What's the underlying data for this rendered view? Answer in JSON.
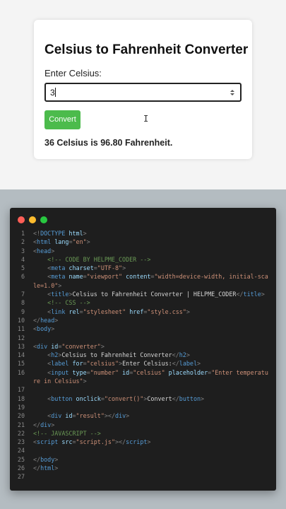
{
  "app": {
    "heading": "Celsius to Fahrenheit Converter",
    "input_label": "Enter Celsius:",
    "input_value": "3",
    "button_label": "Convert",
    "result": "36 Celsius is 96.80 Fahrenheit.",
    "colors": {
      "button": "#4cbb4c",
      "card": "#ffffff",
      "background": "#f4f4f4"
    }
  },
  "editor": {
    "window_buttons": [
      {
        "name": "close",
        "color": "#ff5f57"
      },
      {
        "name": "minimize",
        "color": "#febc2e"
      },
      {
        "name": "maximize",
        "color": "#28c840"
      }
    ],
    "lines": [
      {
        "n": "1",
        "code": [
          [
            "p",
            "<!"
          ],
          [
            "t",
            "DOCTYPE"
          ],
          [
            "w",
            " "
          ],
          [
            "a",
            "html"
          ],
          [
            "p",
            ">"
          ]
        ]
      },
      {
        "n": "2",
        "code": [
          [
            "p",
            "<"
          ],
          [
            "t",
            "html"
          ],
          [
            "w",
            " "
          ],
          [
            "a",
            "lang"
          ],
          [
            "p",
            "="
          ],
          [
            "s",
            "\"en\""
          ],
          [
            "p",
            ">"
          ]
        ]
      },
      {
        "n": "3",
        "code": [
          [
            "p",
            "<"
          ],
          [
            "t",
            "head"
          ],
          [
            "p",
            ">"
          ]
        ]
      },
      {
        "n": "4",
        "code": [
          [
            "w",
            "    "
          ],
          [
            "c",
            "<!-- CODE BY HELPME_CODER -->"
          ]
        ]
      },
      {
        "n": "5",
        "code": [
          [
            "w",
            "    "
          ],
          [
            "p",
            "<"
          ],
          [
            "t",
            "meta"
          ],
          [
            "w",
            " "
          ],
          [
            "a",
            "charset"
          ],
          [
            "p",
            "="
          ],
          [
            "s",
            "\"UTF-8\""
          ],
          [
            "p",
            ">"
          ]
        ]
      },
      {
        "n": "6",
        "code": [
          [
            "w",
            "    "
          ],
          [
            "p",
            "<"
          ],
          [
            "t",
            "meta"
          ],
          [
            "w",
            " "
          ],
          [
            "a",
            "name"
          ],
          [
            "p",
            "="
          ],
          [
            "s",
            "\"viewport\""
          ],
          [
            "w",
            " "
          ],
          [
            "a",
            "content"
          ],
          [
            "p",
            "="
          ],
          [
            "s",
            "\"width=device-width, initial-sca"
          ]
        ]
      },
      {
        "n": "",
        "code": [
          [
            "s",
            "le=1.0\""
          ],
          [
            "p",
            ">"
          ]
        ]
      },
      {
        "n": "7",
        "code": [
          [
            "w",
            "    "
          ],
          [
            "p",
            "<"
          ],
          [
            "t",
            "title"
          ],
          [
            "p",
            ">"
          ],
          [
            "w",
            "Celsius to Fahrenheit Converter | HELPME_CODER"
          ],
          [
            "p",
            "</"
          ],
          [
            "t",
            "title"
          ],
          [
            "p",
            ">"
          ]
        ]
      },
      {
        "n": "8",
        "code": [
          [
            "w",
            "    "
          ],
          [
            "c",
            "<!-- CSS -->"
          ]
        ]
      },
      {
        "n": "9",
        "code": [
          [
            "w",
            "    "
          ],
          [
            "p",
            "<"
          ],
          [
            "t",
            "link"
          ],
          [
            "w",
            " "
          ],
          [
            "a",
            "rel"
          ],
          [
            "p",
            "="
          ],
          [
            "s",
            "\"stylesheet\""
          ],
          [
            "w",
            " "
          ],
          [
            "a",
            "href"
          ],
          [
            "p",
            "="
          ],
          [
            "s",
            "\"style.css\""
          ],
          [
            "p",
            ">"
          ]
        ]
      },
      {
        "n": "10",
        "code": [
          [
            "p",
            "</"
          ],
          [
            "t",
            "head"
          ],
          [
            "p",
            ">"
          ]
        ]
      },
      {
        "n": "11",
        "code": [
          [
            "p",
            "<"
          ],
          [
            "t",
            "body"
          ],
          [
            "p",
            ">"
          ]
        ]
      },
      {
        "n": "12",
        "code": []
      },
      {
        "n": "13",
        "code": [
          [
            "p",
            "<"
          ],
          [
            "t",
            "div"
          ],
          [
            "w",
            " "
          ],
          [
            "a",
            "id"
          ],
          [
            "p",
            "="
          ],
          [
            "s",
            "\"converter\""
          ],
          [
            "p",
            ">"
          ]
        ]
      },
      {
        "n": "14",
        "code": [
          [
            "w",
            "    "
          ],
          [
            "p",
            "<"
          ],
          [
            "t",
            "h2"
          ],
          [
            "p",
            ">"
          ],
          [
            "w",
            "Celsius to Fahrenheit Converter"
          ],
          [
            "p",
            "</"
          ],
          [
            "t",
            "h2"
          ],
          [
            "p",
            ">"
          ]
        ]
      },
      {
        "n": "15",
        "code": [
          [
            "w",
            "    "
          ],
          [
            "p",
            "<"
          ],
          [
            "t",
            "label"
          ],
          [
            "w",
            " "
          ],
          [
            "a",
            "for"
          ],
          [
            "p",
            "="
          ],
          [
            "s",
            "\"celsius\""
          ],
          [
            "p",
            ">"
          ],
          [
            "w",
            "Enter Celsius:"
          ],
          [
            "p",
            "</"
          ],
          [
            "t",
            "label"
          ],
          [
            "p",
            ">"
          ]
        ]
      },
      {
        "n": "16",
        "code": [
          [
            "w",
            "    "
          ],
          [
            "p",
            "<"
          ],
          [
            "t",
            "input"
          ],
          [
            "w",
            " "
          ],
          [
            "a",
            "type"
          ],
          [
            "p",
            "="
          ],
          [
            "s",
            "\"number\""
          ],
          [
            "w",
            " "
          ],
          [
            "a",
            "id"
          ],
          [
            "p",
            "="
          ],
          [
            "s",
            "\"celsius\""
          ],
          [
            "w",
            " "
          ],
          [
            "a",
            "placeholder"
          ],
          [
            "p",
            "="
          ],
          [
            "s",
            "\"Enter temperatu"
          ]
        ]
      },
      {
        "n": "",
        "code": [
          [
            "s",
            "re in Celsius\""
          ],
          [
            "p",
            ">"
          ]
        ]
      },
      {
        "n": "17",
        "code": []
      },
      {
        "n": "18",
        "code": [
          [
            "w",
            "    "
          ],
          [
            "p",
            "<"
          ],
          [
            "t",
            "button"
          ],
          [
            "w",
            " "
          ],
          [
            "a",
            "onclick"
          ],
          [
            "p",
            "="
          ],
          [
            "s",
            "\"convert()\""
          ],
          [
            "p",
            ">"
          ],
          [
            "w",
            "Convert"
          ],
          [
            "p",
            "</"
          ],
          [
            "t",
            "button"
          ],
          [
            "p",
            ">"
          ]
        ]
      },
      {
        "n": "19",
        "code": []
      },
      {
        "n": "20",
        "code": [
          [
            "w",
            "    "
          ],
          [
            "p",
            "<"
          ],
          [
            "t",
            "div"
          ],
          [
            "w",
            " "
          ],
          [
            "a",
            "id"
          ],
          [
            "p",
            "="
          ],
          [
            "s",
            "\"result\""
          ],
          [
            "p",
            "></"
          ],
          [
            "t",
            "div"
          ],
          [
            "p",
            ">"
          ]
        ]
      },
      {
        "n": "21",
        "code": [
          [
            "p",
            "</"
          ],
          [
            "t",
            "div"
          ],
          [
            "p",
            ">"
          ]
        ]
      },
      {
        "n": "22",
        "code": [
          [
            "c",
            "<!-- JAVASCRIPT -->"
          ]
        ]
      },
      {
        "n": "23",
        "code": [
          [
            "p",
            "<"
          ],
          [
            "t",
            "script"
          ],
          [
            "w",
            " "
          ],
          [
            "a",
            "src"
          ],
          [
            "p",
            "="
          ],
          [
            "s",
            "\"script.js\""
          ],
          [
            "p",
            "></"
          ],
          [
            "t",
            "script"
          ],
          [
            "p",
            ">"
          ]
        ]
      },
      {
        "n": "24",
        "code": []
      },
      {
        "n": "25",
        "code": [
          [
            "p",
            "</"
          ],
          [
            "t",
            "body"
          ],
          [
            "p",
            ">"
          ]
        ]
      },
      {
        "n": "26",
        "code": [
          [
            "p",
            "</"
          ],
          [
            "t",
            "html"
          ],
          [
            "p",
            ">"
          ]
        ]
      },
      {
        "n": "27",
        "code": []
      }
    ],
    "colors": {
      "background": "#1e1e1e",
      "tag": "#569cd6",
      "attribute": "#9cdcfe",
      "string": "#ce9178",
      "comment": "#6a9955"
    }
  }
}
